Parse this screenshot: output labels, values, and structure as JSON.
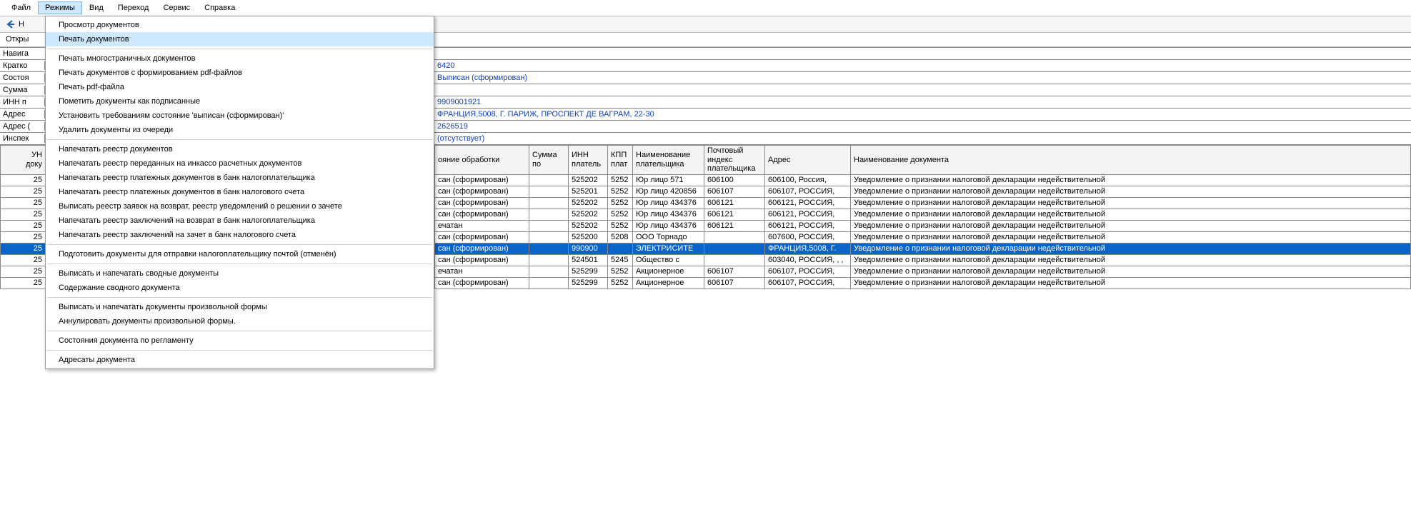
{
  "menubar": {
    "items": [
      "Файл",
      "Режимы",
      "Вид",
      "Переход",
      "Сервис",
      "Справка"
    ],
    "activeIndex": 1
  },
  "toolbar": {
    "back_text_trunc": "Н"
  },
  "secondrow": {
    "text_trunc": "Откры"
  },
  "dropdown": {
    "groups": [
      [
        "Просмотр документов",
        "Печать документов"
      ],
      [
        "Печать многостраничных документов",
        "Печать документов с формированием pdf-файлов",
        "Печать pdf-файла",
        "Пометить документы как подписанные",
        "Установить требованиям состояние 'выписан (сформирован)'",
        "Удалить документы из очереди"
      ],
      [
        "Напечатать реестр документов",
        "Напечатать реестр переданных на инкассо расчетных документов",
        "Напечатать реестр платежных документов в банк налогоплательщика",
        "Напечатать реестр платежных документов в банк налогового счета",
        "Выписать реестр заявок на возврат, реестр уведомлений о решении о зачете",
        "Напечатать реестр заключений на возврат в банк налогоплательщика",
        "Напечатать реестр заключений на зачет в банк налогового счета"
      ],
      [
        "Подготовить документы для отправки налогоплательщику почтой (отменён)"
      ],
      [
        "Выписать и напечатать сводные документы",
        "Содержание сводного документа"
      ],
      [
        "Выписать и напечатать документы произвольной формы",
        "Аннулировать документы произвольной формы."
      ],
      [
        "Состояния документа по регламенту"
      ],
      [
        "Адресаты документа"
      ]
    ],
    "highlightGroup": 0,
    "highlightIndex": 1
  },
  "navigator": {
    "title": "Навига",
    "rows": [
      {
        "label": "Кратко",
        "value": "6420"
      },
      {
        "label": "Состоя",
        "value": "Выписан (сформирован)"
      },
      {
        "label": "Сумма",
        "value": ""
      },
      {
        "label": "ИНН п",
        "value": "9909001921"
      },
      {
        "label": "Адрес",
        "value": "ФРАНЦИЯ,5008, Г. ПАРИЖ, ПРОСПЕКТ ДЕ ВАГРАМ, 22-30"
      },
      {
        "label": "Адрес (",
        "value": "2626519"
      },
      {
        "label": "Инспек",
        "value": "(отсутствует)"
      }
    ]
  },
  "grid": {
    "headers": [
      "УН\nдоку",
      "ояние обработки",
      "Сумма\nпо",
      "ИНН\nплатель",
      "КПП\nплат",
      "Наименование\nплательщика",
      "Почтовый\nиндекс\nплательщика",
      "Адрес",
      "Наименование документа"
    ],
    "rows": [
      {
        "num": "25",
        "state": "сан (сформирован)",
        "sum": "",
        "inn": "525202",
        "kpp": "5252",
        "name": "Юр лицо 571",
        "idx": "606100",
        "addr": "606100, Россия,",
        "doc": "Уведомление о признании налоговой декларации недействительной",
        "selected": false
      },
      {
        "num": "25",
        "state": "сан (сформирован)",
        "sum": "",
        "inn": "525201",
        "kpp": "5252",
        "name": "Юр лицо 420856",
        "idx": "606107",
        "addr": "606107, РОССИЯ,",
        "doc": "Уведомление о признании налоговой декларации недействительной",
        "selected": false
      },
      {
        "num": "25",
        "state": "сан (сформирован)",
        "sum": "",
        "inn": "525202",
        "kpp": "5252",
        "name": "Юр лицо 434376",
        "idx": "606121",
        "addr": "606121, РОССИЯ,",
        "doc": "Уведомление о признании налоговой декларации недействительной",
        "selected": false
      },
      {
        "num": "25",
        "state": "сан (сформирован)",
        "sum": "",
        "inn": "525202",
        "kpp": "5252",
        "name": "Юр лицо 434376",
        "idx": "606121",
        "addr": "606121, РОССИЯ,",
        "doc": "Уведомление о признании налоговой декларации недействительной",
        "selected": false
      },
      {
        "num": "25",
        "state": "ечатан",
        "sum": "",
        "inn": "525202",
        "kpp": "5252",
        "name": "Юр лицо 434376",
        "idx": "606121",
        "addr": "606121, РОССИЯ,",
        "doc": "Уведомление о признании налоговой декларации недействительной",
        "selected": false
      },
      {
        "num": "25",
        "state": "сан (сформирован)",
        "sum": "",
        "inn": "525200",
        "kpp": "5208",
        "name": "ООО Торнадо",
        "idx": "",
        "addr": "607600, РОССИЯ,",
        "doc": "Уведомление о признании налоговой декларации недействительной",
        "selected": false
      },
      {
        "num": "25",
        "state": "сан (сформирован)",
        "sum": "",
        "inn": "990900",
        "kpp": "",
        "name": "ЭЛЕКТРИСИТЕ",
        "idx": "",
        "addr": "ФРАНЦИЯ,5008, Г.",
        "doc": "Уведомление о признании налоговой декларации недействительной",
        "selected": true
      },
      {
        "num": "25",
        "state": "сан (сформирован)",
        "sum": "",
        "inn": "524501",
        "kpp": "5245",
        "name": "Общество с",
        "idx": "",
        "addr": "603040, РОССИЯ, , ,",
        "doc": "Уведомление о признании налоговой декларации недействительной",
        "selected": false
      },
      {
        "num": "25",
        "state": "ечатан",
        "sum": "",
        "inn": "525299",
        "kpp": "5252",
        "name": "Акционерное",
        "idx": "606107",
        "addr": "606107, РОССИЯ,",
        "doc": "Уведомление о признании налоговой декларации недействительной",
        "selected": false
      },
      {
        "num": "25",
        "state": "сан (сформирован)",
        "sum": "",
        "inn": "525299",
        "kpp": "5252",
        "name": "Акционерное",
        "idx": "606107",
        "addr": "606107, РОССИЯ,",
        "doc": "Уведомление о признании налоговой декларации недействительной",
        "selected": false
      }
    ]
  }
}
